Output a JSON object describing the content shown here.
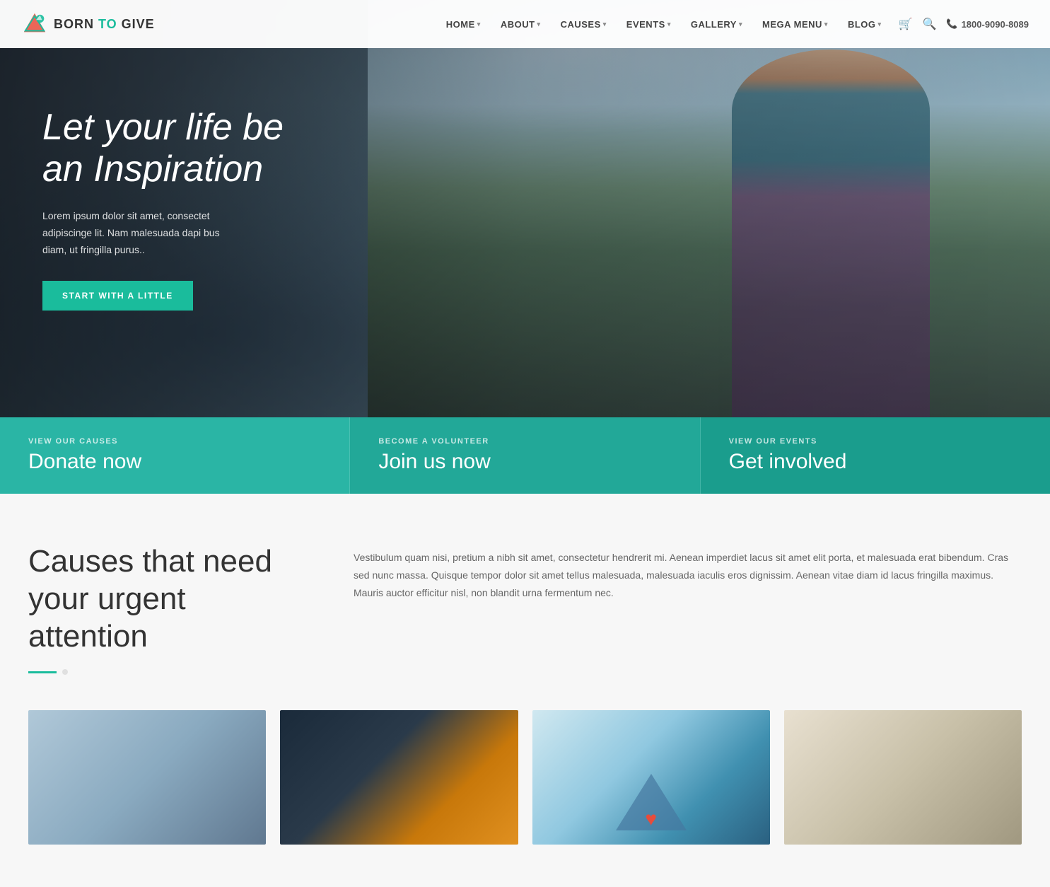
{
  "site": {
    "logo_text_born": "BORN ",
    "logo_text_to": "TO",
    "logo_text_give": " GIVE"
  },
  "nav": {
    "items": [
      {
        "label": "HOME",
        "has_dropdown": true
      },
      {
        "label": "ABOUT",
        "has_dropdown": true
      },
      {
        "label": "CAUSES",
        "has_dropdown": true
      },
      {
        "label": "EVENTS",
        "has_dropdown": true
      },
      {
        "label": "GALLERY",
        "has_dropdown": true
      },
      {
        "label": "MEGA MENU",
        "has_dropdown": true
      },
      {
        "label": "BLOG",
        "has_dropdown": true
      }
    ],
    "phone": "1800-9090-8089"
  },
  "hero": {
    "title": "Let your life be an Inspiration",
    "description": "Lorem ipsum dolor sit amet, consectet adipiscinge lit. Nam malesuada dapi bus diam, ut fringilla purus..",
    "cta_button": "START WITH A LITTLE"
  },
  "cta_bar": [
    {
      "sub": "VIEW OUR CAUSES",
      "title": "Donate now"
    },
    {
      "sub": "BECOME A VOLUNTEER",
      "title": "Join us now"
    },
    {
      "sub": "VIEW OUR EVENTS",
      "title": "Get involved"
    }
  ],
  "causes_section": {
    "heading": "Causes that need your urgent attention",
    "description": "Vestibulum quam nisi, pretium a nibh sit amet, consectetur hendrerit mi. Aenean imperdiet lacus sit amet elit porta, et malesuada erat bibendum. Cras sed nunc massa. Quisque tempor dolor sit amet tellus malesuada, malesuada iaculis eros dignissim. Aenean vitae diam id lacus fringilla maximus. Mauris auctor efficitur nisl, non blandit urna fermentum nec."
  },
  "icons": {
    "cart": "🛒",
    "search": "🔍",
    "phone": "📞",
    "dropdown_arrow": "▾"
  }
}
